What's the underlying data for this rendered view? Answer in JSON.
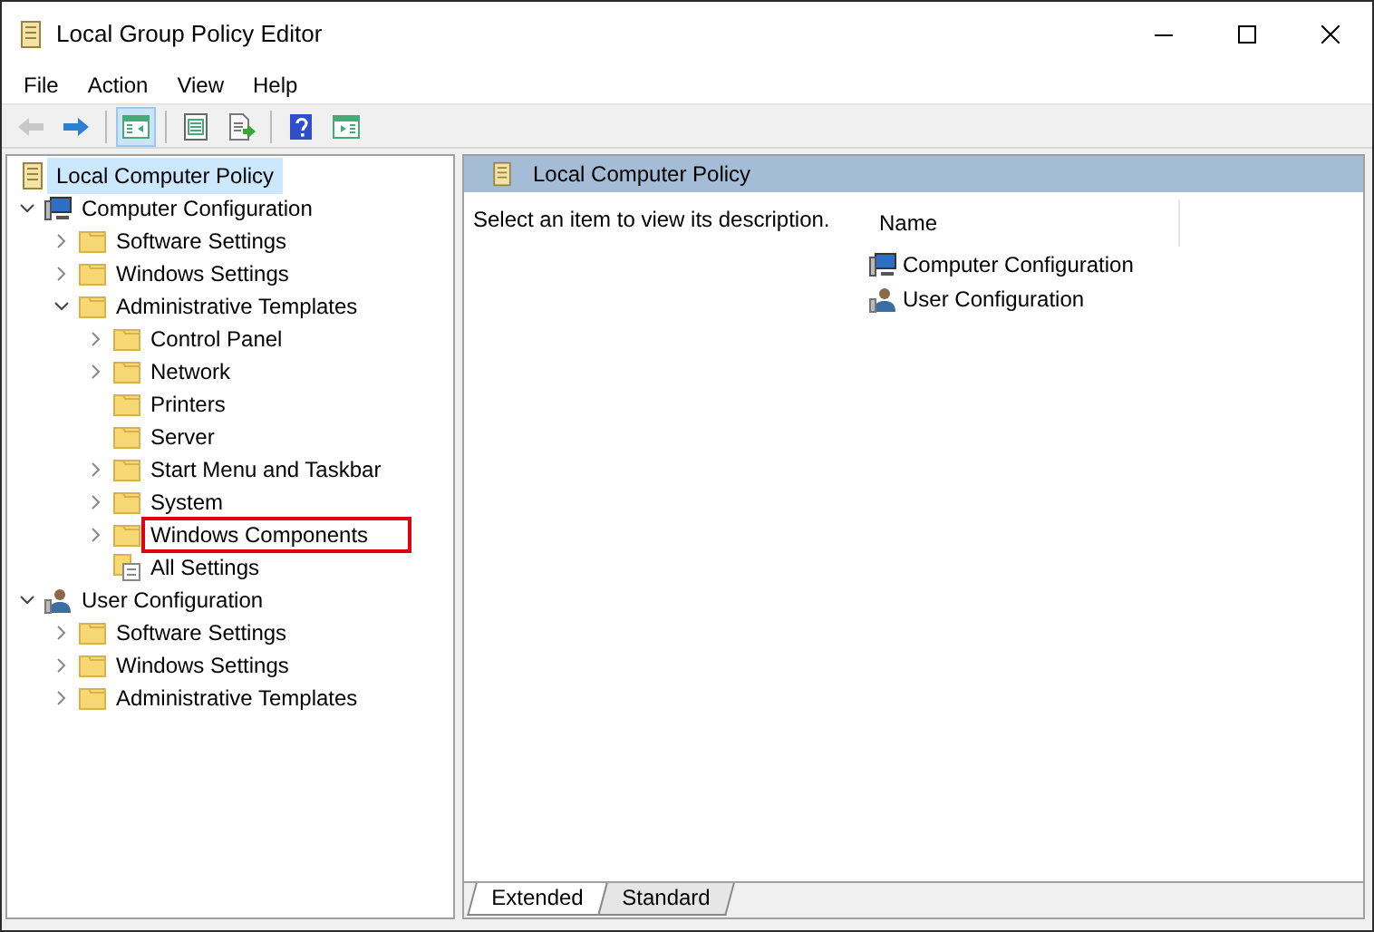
{
  "window": {
    "title": "Local Group Policy Editor"
  },
  "menu": [
    "File",
    "Action",
    "View",
    "Help"
  ],
  "toolbar": [
    {
      "kind": "back",
      "disabled": true,
      "pressed": false
    },
    {
      "kind": "forward",
      "disabled": false,
      "pressed": false
    },
    {
      "kind": "separator"
    },
    {
      "kind": "console-tree",
      "disabled": false,
      "pressed": true
    },
    {
      "kind": "separator"
    },
    {
      "kind": "properties",
      "disabled": false,
      "pressed": false
    },
    {
      "kind": "export",
      "disabled": false,
      "pressed": false
    },
    {
      "kind": "separator"
    },
    {
      "kind": "help",
      "disabled": false,
      "pressed": false
    },
    {
      "kind": "action-pane",
      "disabled": false,
      "pressed": false
    }
  ],
  "tree": {
    "label": "Local Computer Policy",
    "kind": "policy",
    "selected": true,
    "highlighted": false,
    "children": [
      {
        "label": "Computer Configuration",
        "kind": "computer",
        "expanded": true,
        "selected": false,
        "highlighted": false,
        "children": [
          {
            "label": "Software Settings",
            "kind": "folder",
            "expanded": false,
            "selected": false,
            "highlighted": false
          },
          {
            "label": "Windows Settings",
            "kind": "folder",
            "expanded": false,
            "selected": false,
            "highlighted": false
          },
          {
            "label": "Administrative Templates",
            "kind": "folder",
            "expanded": true,
            "selected": false,
            "highlighted": false,
            "children": [
              {
                "label": "Control Panel",
                "kind": "folder",
                "expanded": false,
                "selected": false,
                "highlighted": false
              },
              {
                "label": "Network",
                "kind": "folder",
                "expanded": false,
                "selected": false,
                "highlighted": false
              },
              {
                "label": "Printers",
                "kind": "folder",
                "selected": false,
                "highlighted": false
              },
              {
                "label": "Server",
                "kind": "folder",
                "selected": false,
                "highlighted": false
              },
              {
                "label": "Start Menu and Taskbar",
                "kind": "folder",
                "expanded": false,
                "selected": false,
                "highlighted": false
              },
              {
                "label": "System",
                "kind": "folder",
                "expanded": false,
                "selected": false,
                "highlighted": false
              },
              {
                "label": "Windows Components",
                "kind": "folder",
                "expanded": false,
                "selected": false,
                "highlighted": true
              },
              {
                "label": "All Settings",
                "kind": "settings",
                "selected": false,
                "highlighted": false
              }
            ]
          }
        ]
      },
      {
        "label": "User Configuration",
        "kind": "user",
        "expanded": true,
        "selected": false,
        "highlighted": false,
        "children": [
          {
            "label": "Software Settings",
            "kind": "folder",
            "expanded": false,
            "selected": false,
            "highlighted": false
          },
          {
            "label": "Windows Settings",
            "kind": "folder",
            "expanded": false,
            "selected": false,
            "highlighted": false
          },
          {
            "label": "Administrative Templates",
            "kind": "folder",
            "expanded": false,
            "selected": false,
            "highlighted": false
          }
        ]
      }
    ]
  },
  "details": {
    "title": "Local Computer Policy",
    "description": "Select an item to view its description.",
    "columns": [
      "Name"
    ],
    "items": [
      {
        "label": "Computer Configuration",
        "kind": "computer"
      },
      {
        "label": "User Configuration",
        "kind": "user"
      }
    ]
  },
  "tabs": [
    {
      "label": "Extended",
      "selected": true
    },
    {
      "label": "Standard",
      "selected": false
    }
  ]
}
